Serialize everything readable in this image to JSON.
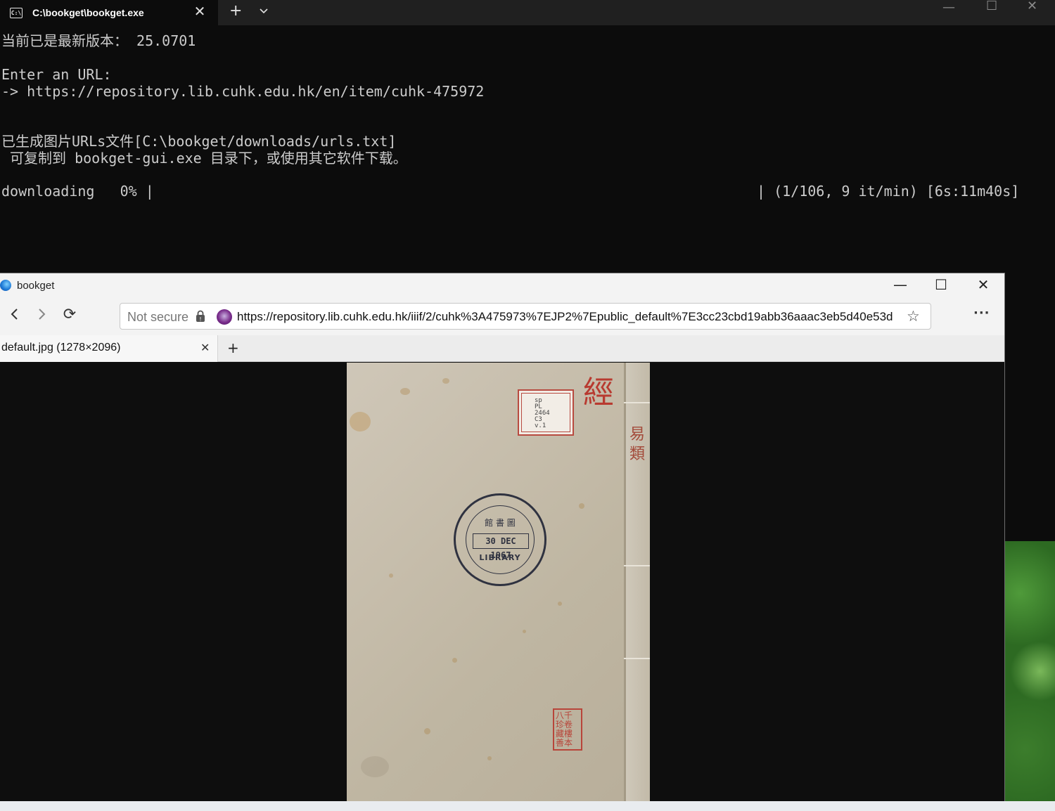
{
  "terminal": {
    "tab_title": "C:\\bookget\\bookget.exe",
    "tab_icon": "terminal-icon",
    "new_tab": "+",
    "lines": [
      "当前已是最新版本： 25.0701",
      "",
      "Enter an URL:",
      "-> https://repository.lib.cuhk.edu.hk/en/item/cuhk-475972",
      "",
      "",
      "已生成图片URLs文件[C:\\bookget/downloads/urls.txt]",
      " 可复制到 bookget-gui.exe 目录下，或使用其它软件下载。",
      "",
      "downloading   0% |"
    ],
    "progress_right": "| (1/106, 9 it/min) [6s:11m40s]"
  },
  "browser": {
    "app_name": "bookget",
    "address": {
      "not_secure": "Not secure",
      "url": "https://repository.lib.cuhk.edu.hk/iiif/2/cuhk%3A475973%7EJP2%7Epublic_default%7E3cc23cbd19abb36aaac3eb5d40e53d"
    },
    "tab": {
      "title": "default.jpg (1278×2096)"
    },
    "new_tab": "+",
    "more": "···"
  },
  "cover": {
    "label_text": "sp\nPL\n2464\nC3\nv.1",
    "stamp_top": "館 書 圖",
    "stamp_date": "30 DEC 1967",
    "stamp_library": "LIBRARY"
  }
}
